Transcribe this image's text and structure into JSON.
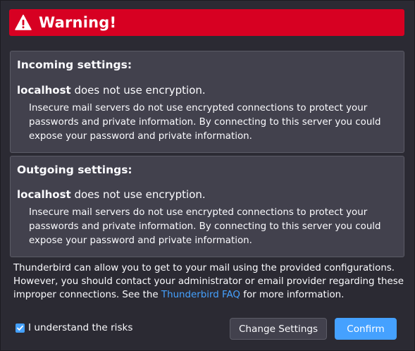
{
  "banner": {
    "title": "Warning!"
  },
  "incoming": {
    "heading": "Incoming settings:",
    "host": "localhost",
    "host_suffix": " does not use encryption.",
    "description": "Insecure mail servers do not use encrypted connections to protect your passwords and private information. By connecting to this server you could expose your password and private information."
  },
  "outgoing": {
    "heading": "Outgoing settings:",
    "host": "localhost",
    "host_suffix": " does not use encryption.",
    "description": "Insecure mail servers do not use encrypted connections to protect your passwords and private information. By connecting to this server you could expose your password and private information."
  },
  "footer": {
    "text_before": "Thunderbird can allow you to get to your mail using the provided configurations. However, you should contact your administrator or email provider regarding these improper connections. See the ",
    "link_text": "Thunderbird FAQ",
    "text_after": " for more information."
  },
  "risk": {
    "label": "I understand the risks",
    "checked": true
  },
  "buttons": {
    "change_settings": "Change Settings",
    "confirm": "Confirm"
  },
  "colors": {
    "banner": "#d70022",
    "accent": "#45a1ff",
    "background": "#2b2a33",
    "box": "#42414d"
  }
}
